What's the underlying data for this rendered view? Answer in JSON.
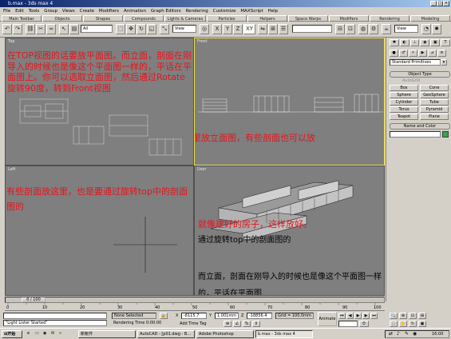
{
  "window": {
    "title": "b.max - 3ds max 4",
    "controls": [
      "_",
      "□",
      "×"
    ]
  },
  "menu": [
    "File",
    "Edit",
    "Tools",
    "Group",
    "Views",
    "Create",
    "Modifiers",
    "Animation",
    "Graph Editors",
    "Rendering",
    "Customize",
    "MAXScript",
    "Help"
  ],
  "tabs": [
    "Main Toolbar",
    "Objects",
    "Shapes",
    "Compounds",
    "Lights & Cameras",
    "Particles",
    "Helpers",
    "Space Warps",
    "Modifiers",
    "Rendering",
    "Modeling"
  ],
  "toolbar": {
    "selection_filter": "All",
    "ref_coord": "View",
    "axes": [
      "X",
      "Y",
      "Z",
      "XY"
    ],
    "view_dropdown": "View"
  },
  "viewports": {
    "top": {
      "label": "Top",
      "annotation": "在TOP视图的话要放平面图。而立面，剖面在刚导入的时候也是像这个平面图一样的，平话在平面图上。你可以选取立面图，然后通过Rotate旋转90度，转到Front视图"
    },
    "front": {
      "label": "Front",
      "annotation": "这里放立面图，有些剖面也可以放"
    },
    "left": {
      "label": "Left",
      "annotation": "有些剖面放这里，也是要通过旋转top中的剖面图的"
    },
    "user": {
      "label": "User",
      "annotation_red": "就像建好的房子，这样放好。",
      "annotation_black_1": "通过旋转top中的剖面图的",
      "annotation_black_2": "而立面，剖面在刚导入的时候也是像这个平面图一样的，平话在平面图"
    }
  },
  "command_panel": {
    "dropdown": "Standard Primitives",
    "rollout_title": "Object Type",
    "autogrid": "AutoGrid",
    "buttons": [
      "Box",
      "Cone",
      "Sphere",
      "GeoSphere",
      "Cylinder",
      "Tube",
      "Torus",
      "Pyramid",
      "Teapot",
      "Plane"
    ],
    "name_color_title": "Name and Color",
    "color": "#2fa84f"
  },
  "timeline": {
    "frame": "0 / 100",
    "ticks": [
      "0",
      "10",
      "20",
      "30",
      "40",
      "50",
      "60",
      "70",
      "80",
      "90",
      "100"
    ]
  },
  "status": {
    "listener": "\"Light Lister Started\"",
    "selection": "None Selected",
    "rendering": "Rendering Time 0:00:00",
    "x": "-8115.7",
    "y": "1.001mm",
    "z": "-18856.4",
    "grid": "Grid = 100.0mm",
    "animate": "Animate",
    "add_time_tag": "Add Time Tag"
  },
  "taskbar": {
    "start": "开始",
    "items": [
      "新帐件",
      "AutoCAD - [p01.dwg - B...",
      "Adobe Photoshop",
      "b.max - 3ds max 4"
    ],
    "clock": "16:00"
  }
}
